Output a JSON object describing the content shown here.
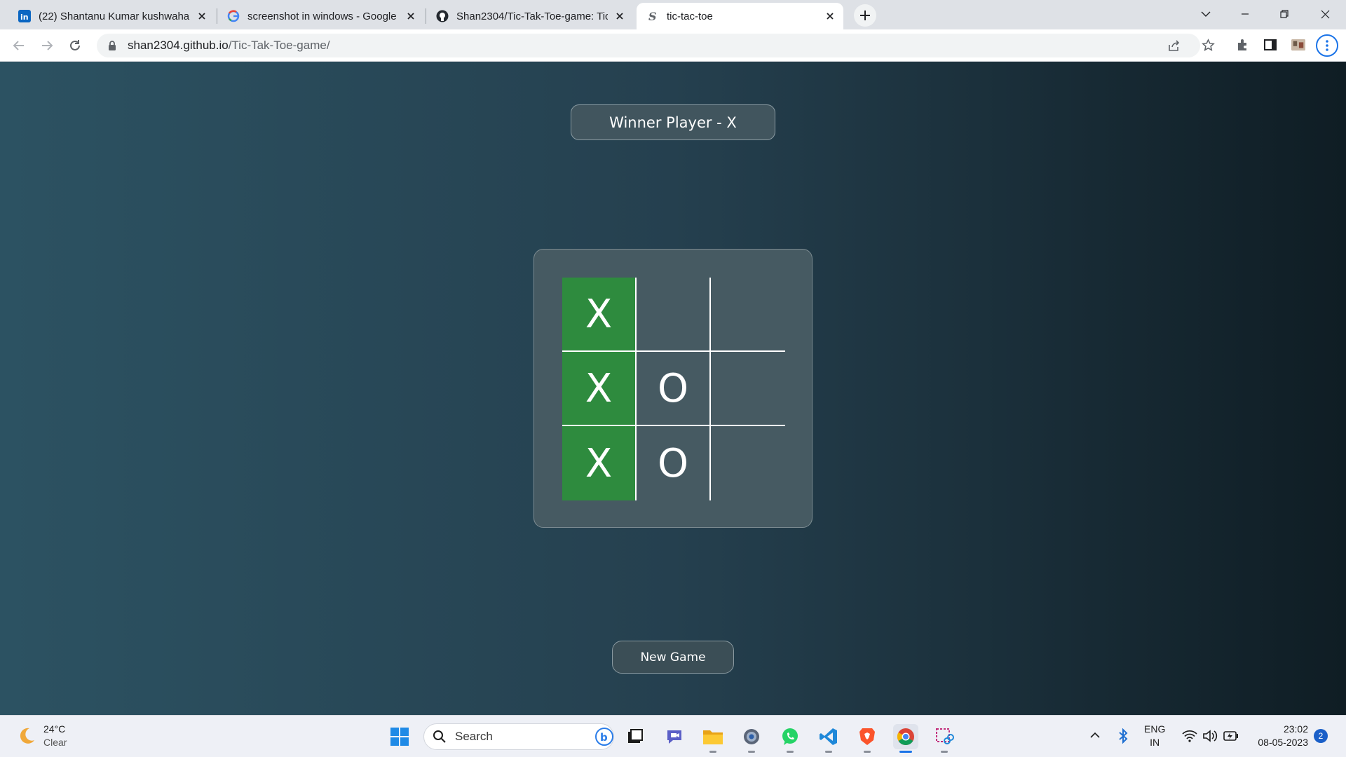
{
  "browser": {
    "tabs": [
      {
        "title": "(22) Shantanu Kumar kushwaha |",
        "icon": "linkedin-icon",
        "active": false
      },
      {
        "title": "screenshot in windows - Google",
        "icon": "google-icon",
        "active": false
      },
      {
        "title": "Shan2304/Tic-Tak-Toe-game: Tic",
        "icon": "github-icon",
        "active": false
      },
      {
        "title": "tic-tac-toe",
        "icon": "site-icon",
        "active": true
      }
    ],
    "url_host": "shan2304.github.io",
    "url_path": "/Tic-Tak-Toe-game/"
  },
  "game": {
    "status": "Winner Player - X",
    "board": [
      [
        "X",
        "",
        ""
      ],
      [
        "X",
        "O",
        ""
      ],
      [
        "X",
        "O",
        ""
      ]
    ],
    "winning_cells": [
      [
        0,
        0
      ],
      [
        1,
        0
      ],
      [
        2,
        0
      ]
    ],
    "new_game_label": "New Game",
    "colors": {
      "winning_cell": "#2e8b3e",
      "grid_line": "#ffffff",
      "card": "#465a62"
    }
  },
  "taskbar": {
    "weather": {
      "temp": "24°C",
      "condition": "Clear"
    },
    "search_label": "Search",
    "apps": [
      "start-icon",
      "search",
      "task-view-icon",
      "teams-icon",
      "file-explorer-icon",
      "settings-icon",
      "whatsapp-icon",
      "vscode-icon",
      "brave-icon",
      "chrome-icon",
      "snipping-tool-icon"
    ],
    "lang_line1": "ENG",
    "lang_line2": "IN",
    "time": "23:02",
    "date": "08-05-2023",
    "notifications": "2"
  }
}
